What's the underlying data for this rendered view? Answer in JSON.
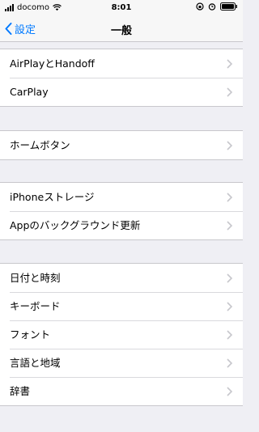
{
  "status_bar": {
    "carrier": "docomo",
    "time": "8:01"
  },
  "nav": {
    "back_label": "設定",
    "title": "一般"
  },
  "groups": [
    {
      "items": [
        "AirPlayとHandoff",
        "CarPlay"
      ]
    },
    {
      "items": [
        "ホームボタン"
      ]
    },
    {
      "items": [
        "iPhoneストレージ",
        "Appのバックグラウンド更新"
      ]
    },
    {
      "items": [
        "日付と時刻",
        "キーボード",
        "フォント",
        "言語と地域",
        "辞書"
      ]
    }
  ],
  "colors": {
    "accent": "#007aff",
    "background": "#efeff4"
  }
}
